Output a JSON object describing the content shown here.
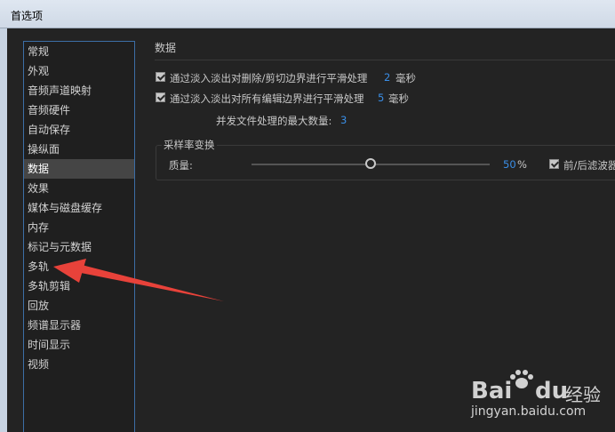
{
  "window": {
    "title": "首选项"
  },
  "sidebar": {
    "items": [
      {
        "label": "常规"
      },
      {
        "label": "外观"
      },
      {
        "label": "音频声道映射"
      },
      {
        "label": "音频硬件"
      },
      {
        "label": "自动保存"
      },
      {
        "label": "操纵面"
      },
      {
        "label": "数据",
        "selected": true
      },
      {
        "label": "效果"
      },
      {
        "label": "媒体与磁盘缓存"
      },
      {
        "label": "内存"
      },
      {
        "label": "标记与元数据"
      },
      {
        "label": "多轨"
      },
      {
        "label": "多轨剪辑"
      },
      {
        "label": "回放"
      },
      {
        "label": "频谱显示器"
      },
      {
        "label": "时间显示"
      },
      {
        "label": "视频"
      }
    ]
  },
  "main": {
    "section_title": "数据",
    "option1": {
      "label": "通过淡入淡出对删除/剪切边界进行平滑处理",
      "value": "2",
      "unit": "毫秒",
      "checked": true
    },
    "option2": {
      "label": "通过淡入淡出对所有编辑边界进行平滑处理",
      "value": "5",
      "unit": "毫秒",
      "checked": true
    },
    "max_files": {
      "label": "并发文件处理的最大数量:",
      "value": "3"
    },
    "sample_rate": {
      "group_title": "采样率变换",
      "quality_label": "质量:",
      "quality_value": "50",
      "quality_unit": "%",
      "quality_fraction": 0.5,
      "filter_label": "前/后滤波器",
      "filter_checked": true
    }
  },
  "watermark": {
    "brand_left": "Bai",
    "brand_right": "du",
    "brand_cn": "经验",
    "url": "jingyan.baidu.com"
  },
  "colors": {
    "accent_value": "#3a8ee6",
    "selected_bg": "#454545",
    "arrow": "#e8423a",
    "sidebar_border": "#3c6ea6"
  }
}
